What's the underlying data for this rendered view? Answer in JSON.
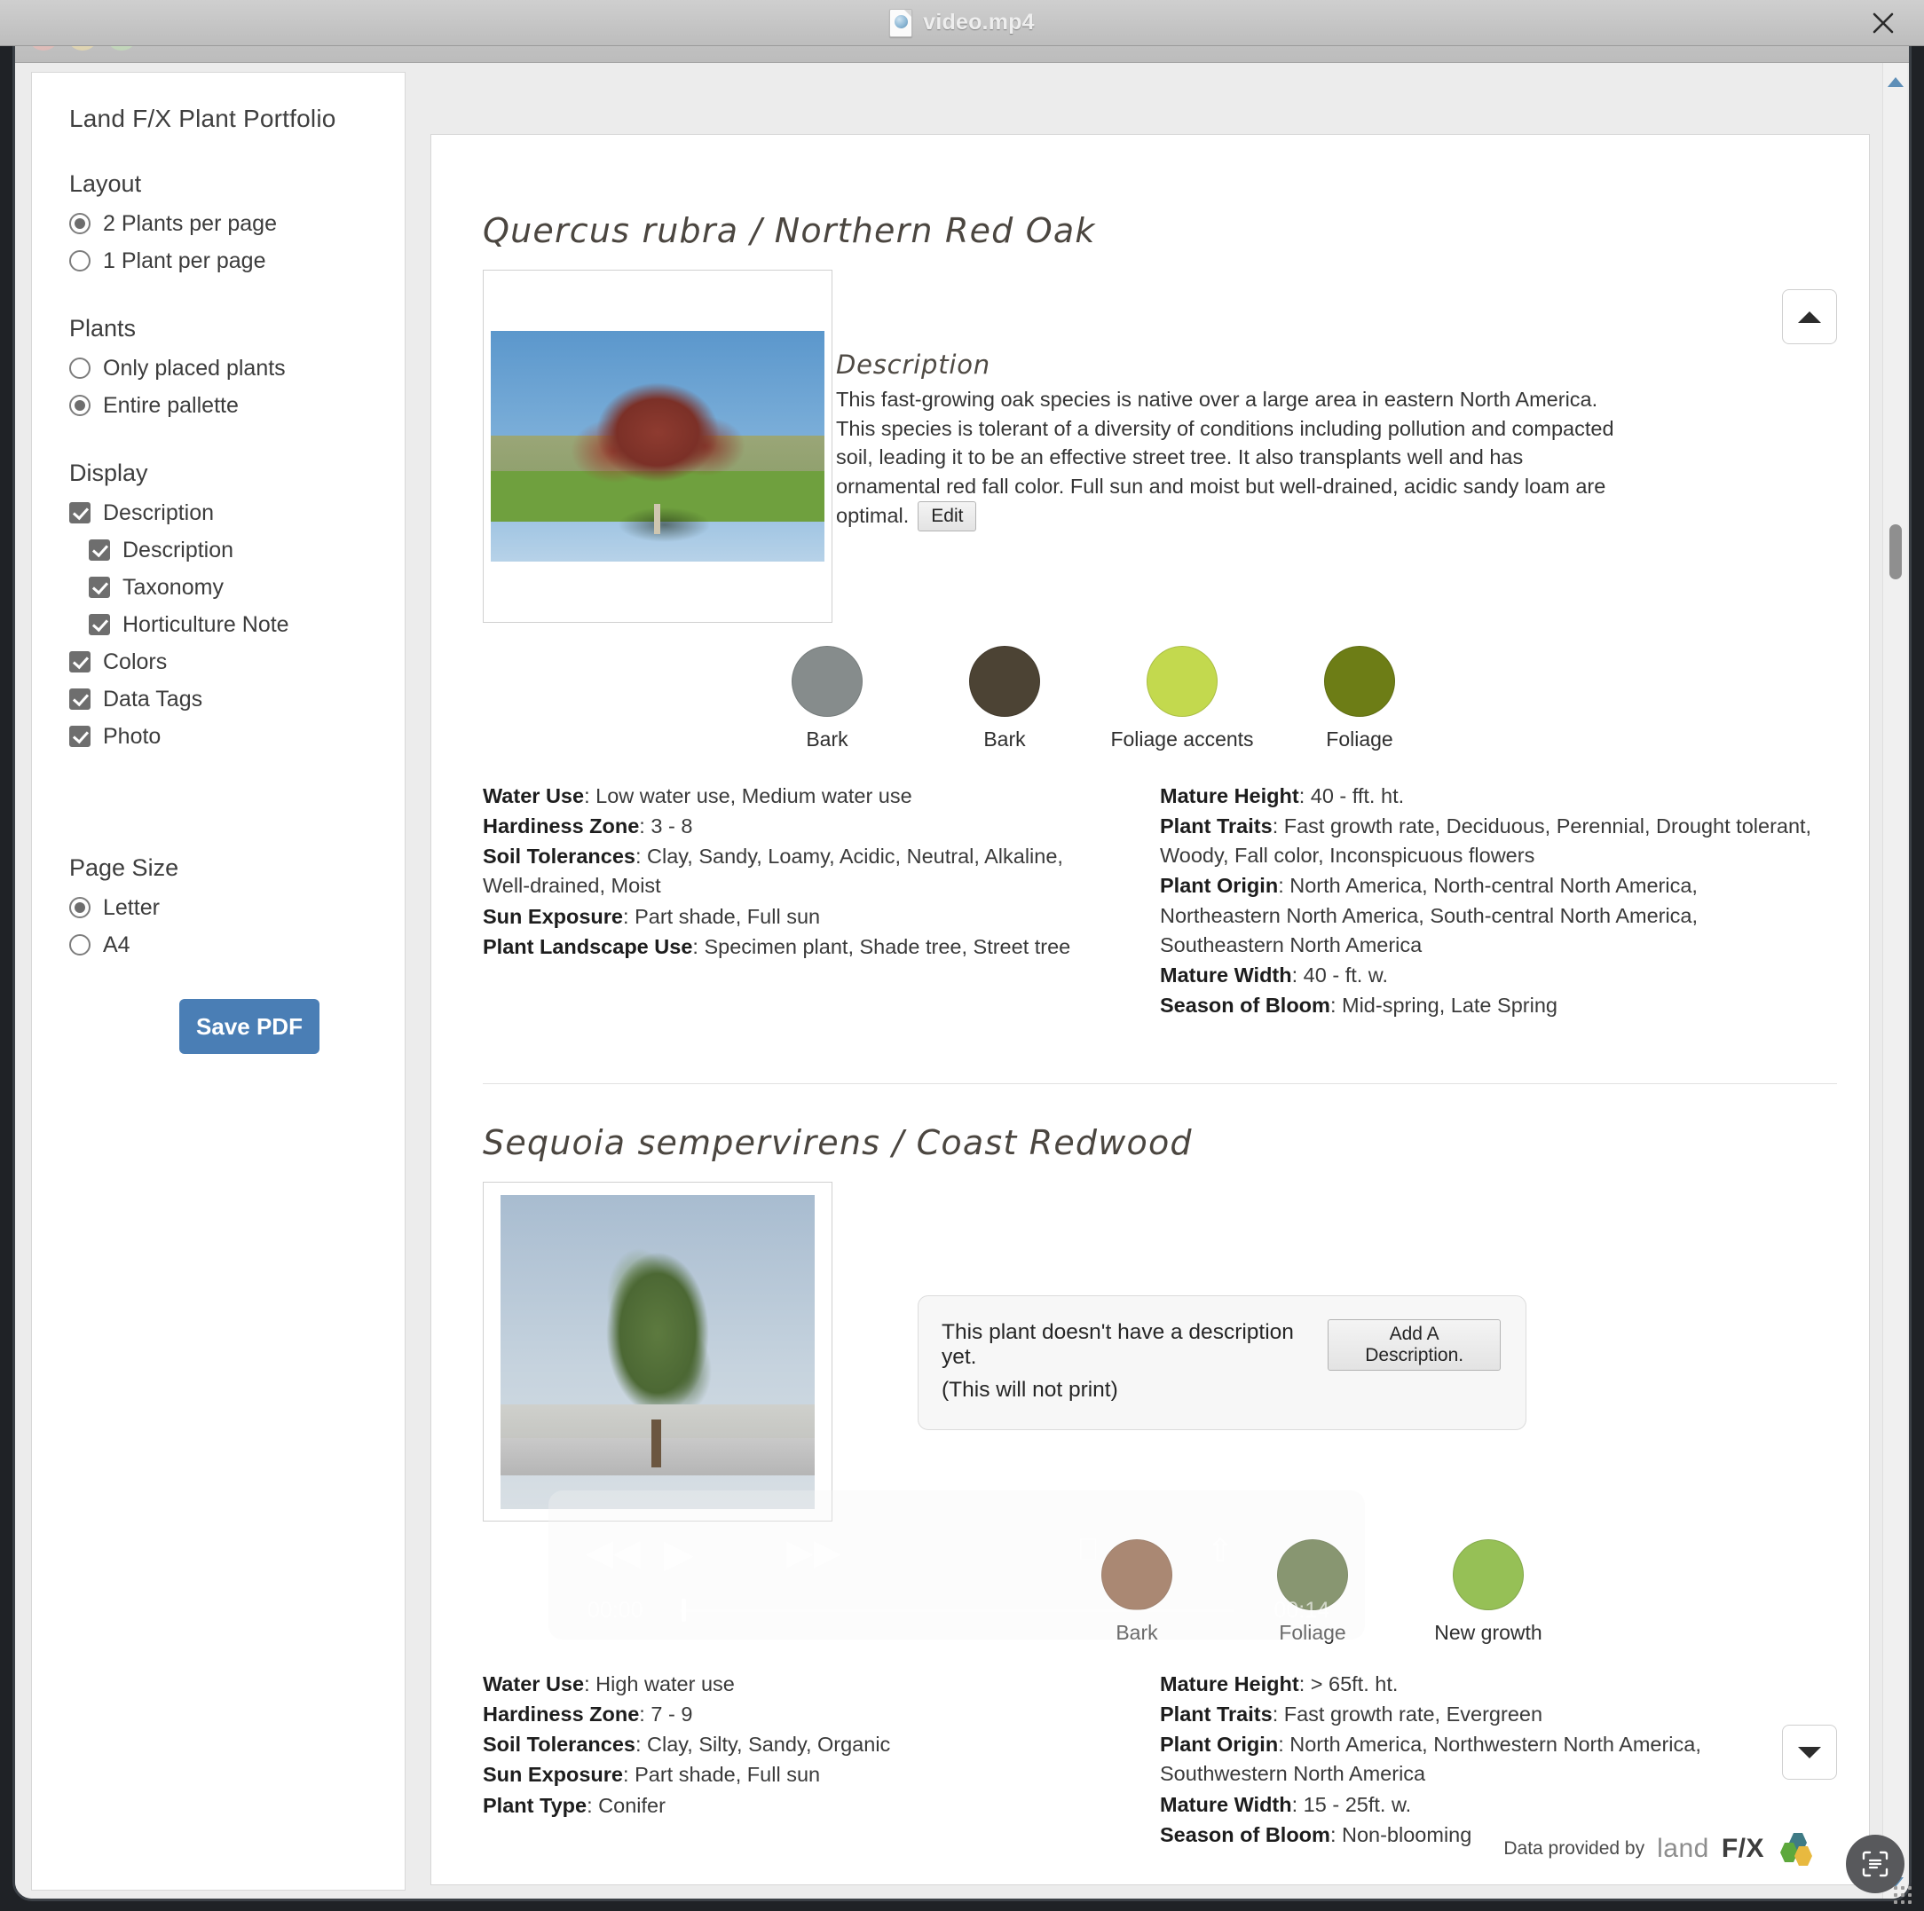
{
  "window": {
    "video_title": "video.mp4",
    "app_title": "Plant Portfolio",
    "close_label": "✕"
  },
  "sidebar": {
    "title": "Land F/X Plant Portfolio",
    "layout": {
      "heading": "Layout",
      "options": [
        {
          "label": "2 Plants per page",
          "selected": true
        },
        {
          "label": "1 Plant per page",
          "selected": false
        }
      ]
    },
    "plants": {
      "heading": "Plants",
      "options": [
        {
          "label": "Only placed plants",
          "selected": false
        },
        {
          "label": "Entire pallette",
          "selected": true
        }
      ]
    },
    "display": {
      "heading": "Display",
      "options": [
        {
          "label": "Description",
          "checked": true,
          "indent": false
        },
        {
          "label": "Description",
          "checked": true,
          "indent": true
        },
        {
          "label": "Taxonomy",
          "checked": true,
          "indent": true
        },
        {
          "label": "Horticulture Note",
          "checked": true,
          "indent": true
        },
        {
          "label": "Colors",
          "checked": true,
          "indent": false
        },
        {
          "label": "Data Tags",
          "checked": true,
          "indent": false
        },
        {
          "label": "Photo",
          "checked": true,
          "indent": false
        }
      ]
    },
    "page_size": {
      "heading": "Page Size",
      "options": [
        {
          "label": "Letter",
          "selected": true
        },
        {
          "label": "A4",
          "selected": false
        }
      ]
    },
    "save_pdf_label": "Save PDF"
  },
  "plants": [
    {
      "title": "Quercus rubra / Northern Red Oak",
      "description_heading": "Description",
      "description_body": "This fast-growing oak species is native over a large area in eastern North America. This species is tolerant of a diversity of conditions including pollution and compacted soil, leading it to be an effective street tree. It also transplants well and has ornamental red fall color. Full sun and moist but well-drained, acidic sandy loam are optimal.",
      "edit_label": "Edit",
      "colors": [
        {
          "caption": "Bark",
          "hex": "#868c8c"
        },
        {
          "caption": "Bark",
          "hex": "#4c4334"
        },
        {
          "caption": "Foliage accents",
          "hex": "#c3d94e"
        },
        {
          "caption": "Foliage",
          "hex": "#6d7d16"
        }
      ],
      "tags_left": [
        {
          "label": "Water Use",
          "value": "Low water use, Medium water use"
        },
        {
          "label": "Hardiness Zone",
          "value": "3 - 8"
        },
        {
          "label": "Soil Tolerances",
          "value": "Clay, Sandy, Loamy, Acidic, Neutral, Alkaline, Well-drained, Moist"
        },
        {
          "label": "Sun Exposure",
          "value": "Part shade, Full sun"
        },
        {
          "label": "Plant Landscape Use",
          "value": "Specimen plant, Shade tree, Street tree"
        }
      ],
      "tags_right": [
        {
          "label": "Mature Height",
          "value": "40 - fft. ht."
        },
        {
          "label": "Plant Traits",
          "value": "Fast growth rate, Deciduous, Perennial, Drought tolerant, Woody, Fall color, Inconspicuous flowers"
        },
        {
          "label": "Plant Origin",
          "value": "North America, North-central North America, Northeastern North America, South-central North America, Southeastern North America"
        },
        {
          "label": "Mature Width",
          "value": "40 - ft. w."
        },
        {
          "label": "Season of Bloom",
          "value": "Mid-spring, Late Spring"
        }
      ]
    },
    {
      "title": "Sequoia sempervirens / Coast Redwood",
      "no_description_line1": "This plant doesn't have a description yet.",
      "no_description_line2": "(This will not print)",
      "add_description_label": "Add A Description.",
      "colors": [
        {
          "caption": "Bark",
          "hex": "#8a5a3c"
        },
        {
          "caption": "Foliage",
          "hex": "#5a6e38"
        },
        {
          "caption": "New growth",
          "hex": "#96c056"
        }
      ],
      "tags_left": [
        {
          "label": "Water Use",
          "value": "High water use"
        },
        {
          "label": "Hardiness Zone",
          "value": "7 - 9"
        },
        {
          "label": "Soil Tolerances",
          "value": "Clay, Silty, Sandy, Organic"
        },
        {
          "label": "Sun Exposure",
          "value": "Part shade, Full sun"
        },
        {
          "label": "Plant Type",
          "value": "Conifer"
        }
      ],
      "tags_right": [
        {
          "label": "Mature Height",
          "value": "> 65ft. ht."
        },
        {
          "label": "Plant Traits",
          "value": "Fast growth rate, Evergreen"
        },
        {
          "label": "Plant Origin",
          "value": "North America, Northwestern North America, Southwestern North America"
        },
        {
          "label": "Mature Width",
          "value": "15 - 25ft. w."
        },
        {
          "label": "Season of Bloom",
          "value": "Non-blooming"
        }
      ]
    }
  ],
  "footer": {
    "credit_text": "Data provided by",
    "logo_land": "land",
    "logo_fx": "F/X"
  },
  "video_overlay": {
    "time_start": "00:00",
    "time_end": "00:14",
    "rewind": "◀◀",
    "play": "▶",
    "forward": "▶▶"
  }
}
